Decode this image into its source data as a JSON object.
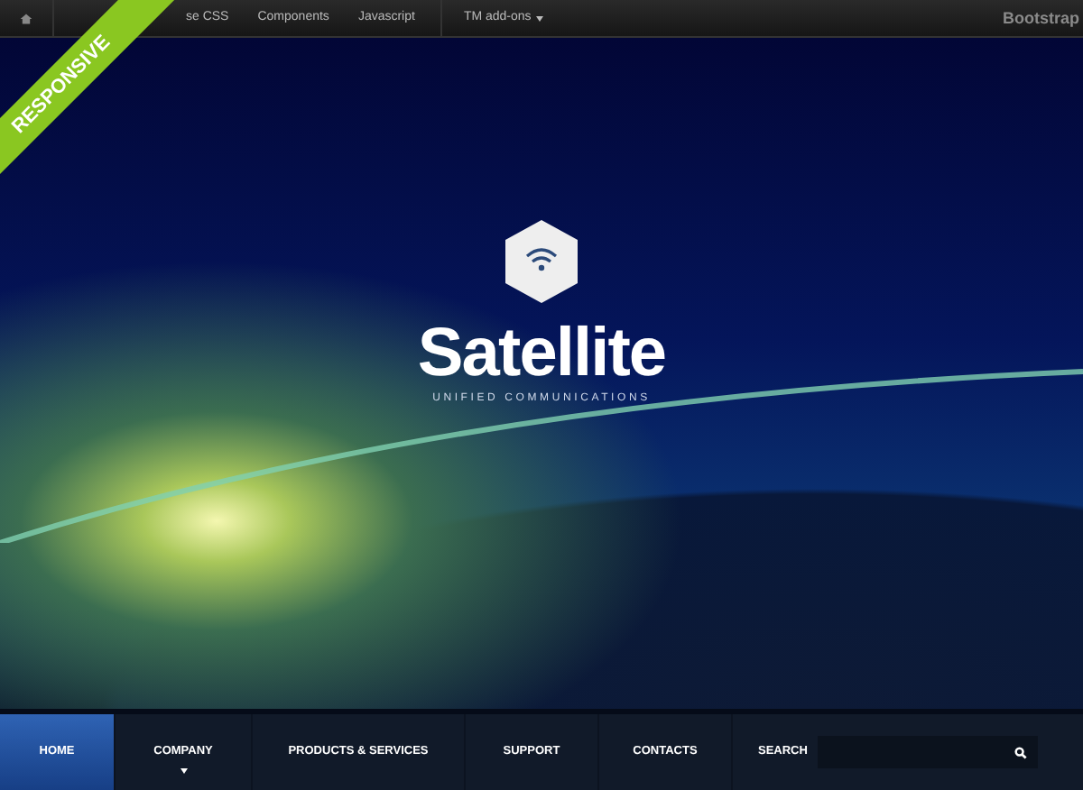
{
  "top_bar": {
    "items": [
      {
        "label": "se CSS",
        "kind": "link"
      },
      {
        "label": "Components",
        "kind": "link"
      },
      {
        "label": "Javascript",
        "kind": "link"
      },
      {
        "label": "TM add-ons",
        "kind": "dropdown"
      }
    ],
    "brand": "Bootstrap"
  },
  "ribbon": {
    "label": "RESPONSIVE"
  },
  "hero": {
    "logo_title": "Satellite",
    "logo_subtitle": "UNIFIED COMMUNICATIONS"
  },
  "nav": {
    "items": [
      {
        "label": "HOME",
        "selected": true,
        "has_submenu": false
      },
      {
        "label": "COMPANY",
        "selected": false,
        "has_submenu": true
      },
      {
        "label": "PRODUCTS & SERVICES",
        "selected": false,
        "has_submenu": false
      },
      {
        "label": "SUPPORT",
        "selected": false,
        "has_submenu": false
      },
      {
        "label": "CONTACTS",
        "selected": false,
        "has_submenu": false
      }
    ],
    "search_label": "SEARCH"
  }
}
